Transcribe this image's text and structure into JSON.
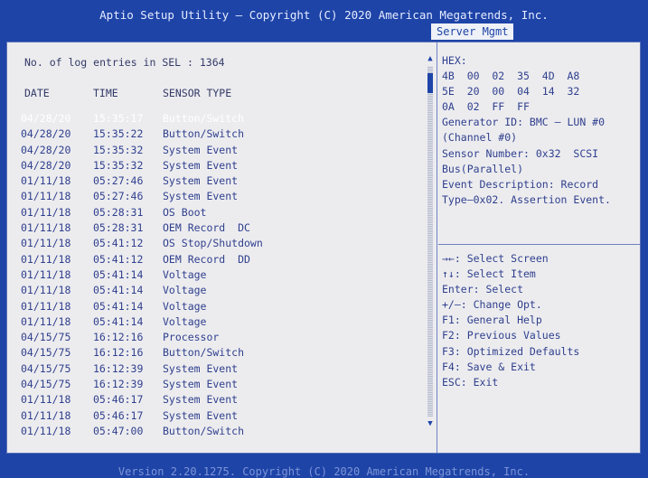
{
  "header": {
    "title": "Aptio Setup Utility – Copyright (C) 2020 American Megatrends, Inc.",
    "active_tab": "Server Mgmt"
  },
  "sel": {
    "count_label": "No. of log entries in SEL : 1364",
    "columns": [
      "DATE",
      "TIME",
      "SENSOR TYPE"
    ],
    "selected_index": 0,
    "rows": [
      {
        "date": "04/28/20",
        "time": "15:35:17",
        "sensor": "Button/Switch"
      },
      {
        "date": "04/28/20",
        "time": "15:35:22",
        "sensor": "Button/Switch"
      },
      {
        "date": "04/28/20",
        "time": "15:35:32",
        "sensor": "System Event"
      },
      {
        "date": "04/28/20",
        "time": "15:35:32",
        "sensor": "System Event"
      },
      {
        "date": "01/11/18",
        "time": "05:27:46",
        "sensor": "System Event"
      },
      {
        "date": "01/11/18",
        "time": "05:27:46",
        "sensor": "System Event"
      },
      {
        "date": "01/11/18",
        "time": "05:28:31",
        "sensor": "OS Boot"
      },
      {
        "date": "01/11/18",
        "time": "05:28:31",
        "sensor": "OEM Record  DC"
      },
      {
        "date": "01/11/18",
        "time": "05:41:12",
        "sensor": "OS Stop/Shutdown"
      },
      {
        "date": "01/11/18",
        "time": "05:41:12",
        "sensor": "OEM Record  DD"
      },
      {
        "date": "01/11/18",
        "time": "05:41:14",
        "sensor": "Voltage"
      },
      {
        "date": "01/11/18",
        "time": "05:41:14",
        "sensor": "Voltage"
      },
      {
        "date": "01/11/18",
        "time": "05:41:14",
        "sensor": "Voltage"
      },
      {
        "date": "01/11/18",
        "time": "05:41:14",
        "sensor": "Voltage"
      },
      {
        "date": "04/15/75",
        "time": "16:12:16",
        "sensor": "Processor"
      },
      {
        "date": "04/15/75",
        "time": "16:12:16",
        "sensor": "Button/Switch"
      },
      {
        "date": "04/15/75",
        "time": "16:12:39",
        "sensor": "System Event"
      },
      {
        "date": "04/15/75",
        "time": "16:12:39",
        "sensor": "System Event"
      },
      {
        "date": "01/11/18",
        "time": "05:46:17",
        "sensor": "System Event"
      },
      {
        "date": "01/11/18",
        "time": "05:46:17",
        "sensor": "System Event"
      },
      {
        "date": "01/11/18",
        "time": "05:47:00",
        "sensor": "Button/Switch"
      }
    ]
  },
  "details": {
    "lines": [
      "HEX:",
      "4B  00  02  35  4D  A8",
      "5E  20  00  04  14  32",
      "0A  02  FF  FF",
      "Generator ID: BMC – LUN #0",
      "(Channel #0)",
      "Sensor Number: 0x32  SCSI",
      "Bus(Parallel)",
      "Event Description: Record",
      "Type–0x02. Assertion Event."
    ]
  },
  "help": {
    "lines": [
      "→←: Select Screen",
      "↑↓: Select Item",
      "Enter: Select",
      "+/–: Change Opt.",
      "F1: General Help",
      "F2: Previous Values",
      "F3: Optimized Defaults",
      "F4: Save & Exit",
      "ESC: Exit"
    ]
  },
  "footer": {
    "text": "Version 2.20.1275. Copyright (C) 2020 American Megatrends, Inc."
  },
  "icons": {
    "scroll_up": "▲",
    "scroll_down": "▼"
  },
  "colors": {
    "background": "#1e44a8",
    "panel": "#ececef",
    "text": "#2f3f8d",
    "selected_text": "#ffffff"
  }
}
